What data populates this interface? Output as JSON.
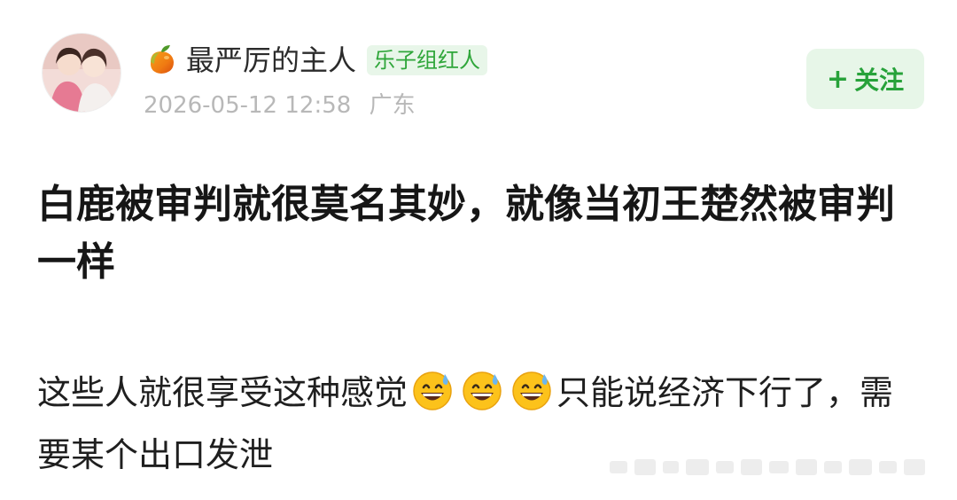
{
  "post": {
    "author": {
      "name": "最严厉的主人",
      "name_icon": "mango-icon",
      "badge": "乐子组红人",
      "avatar_icon": "avatar"
    },
    "meta": {
      "datetime": "2026-05-12 12:58",
      "location": "广东"
    },
    "follow": {
      "plus": "+",
      "label": "关注"
    },
    "title": "白鹿被审判就很莫名其妙，就像当初王楚然被审判一样",
    "body": {
      "before_emoji": "这些人就很享受这种感觉",
      "emoji_count": 3,
      "emoji_icon": "grinning-sweat-emoji",
      "after_emoji": "只能说经济下行了，需要某个出口发泄"
    }
  },
  "colors": {
    "accent_green": "#27a23a",
    "badge_bg": "#e8f6e9",
    "meta_gray": "#b8b8b8"
  }
}
